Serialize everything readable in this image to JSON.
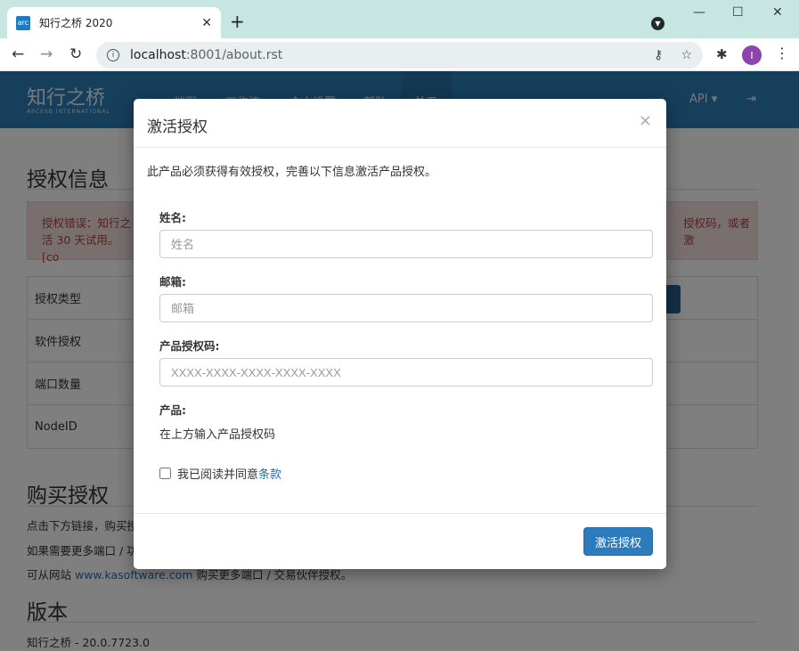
{
  "browser": {
    "tab_title": "知行之桥 2020",
    "favicon_text": "arc",
    "url_host": "localhost",
    "url_path": ":8001/about.rst",
    "profile_initial": "I"
  },
  "nav": {
    "brand": "知行之桥",
    "brand_sub": "ARCESB INTERNATIONAL",
    "items": [
      "档案",
      "工作流",
      "个人设置",
      "帮助",
      "关于"
    ],
    "api_label": "API ▾"
  },
  "page": {
    "license_title": "授权信息",
    "alert_left": "授权错误：知行之",
    "alert_left2": "活 30 天试用。 [co",
    "alert_right": "授权码，或者激",
    "table_rows": [
      "授权类型",
      "软件授权",
      "端口数量",
      "NodeID"
    ],
    "buy_title": "购买授权",
    "buy_line1": "点击下方链接，购买授",
    "buy_line2": "如果需要更多端口 / 功",
    "buy_line3_pre": "可从网站 ",
    "buy_link": "www.kasoftware.com",
    "buy_line3_post": " 购买更多端口 / 交易伙伴授权。",
    "version_title": "版本",
    "version_text": "知行之桥 - 20.0.7723.0"
  },
  "modal": {
    "title": "激活授权",
    "close": "×",
    "description": "此产品必须获得有效授权，完善以下信息激活产品授权。",
    "name_label": "姓名:",
    "name_placeholder": "姓名",
    "email_label": "邮箱:",
    "email_placeholder": "邮箱",
    "code_label": "产品授权码:",
    "code_placeholder": "XXXX-XXXX-XXXX-XXXX-XXXX",
    "product_label": "产品:",
    "product_text": "在上方输入产品授权码",
    "agree_text": "我已阅读并同意",
    "agree_link": "条款",
    "activate_label": "激活授权"
  }
}
